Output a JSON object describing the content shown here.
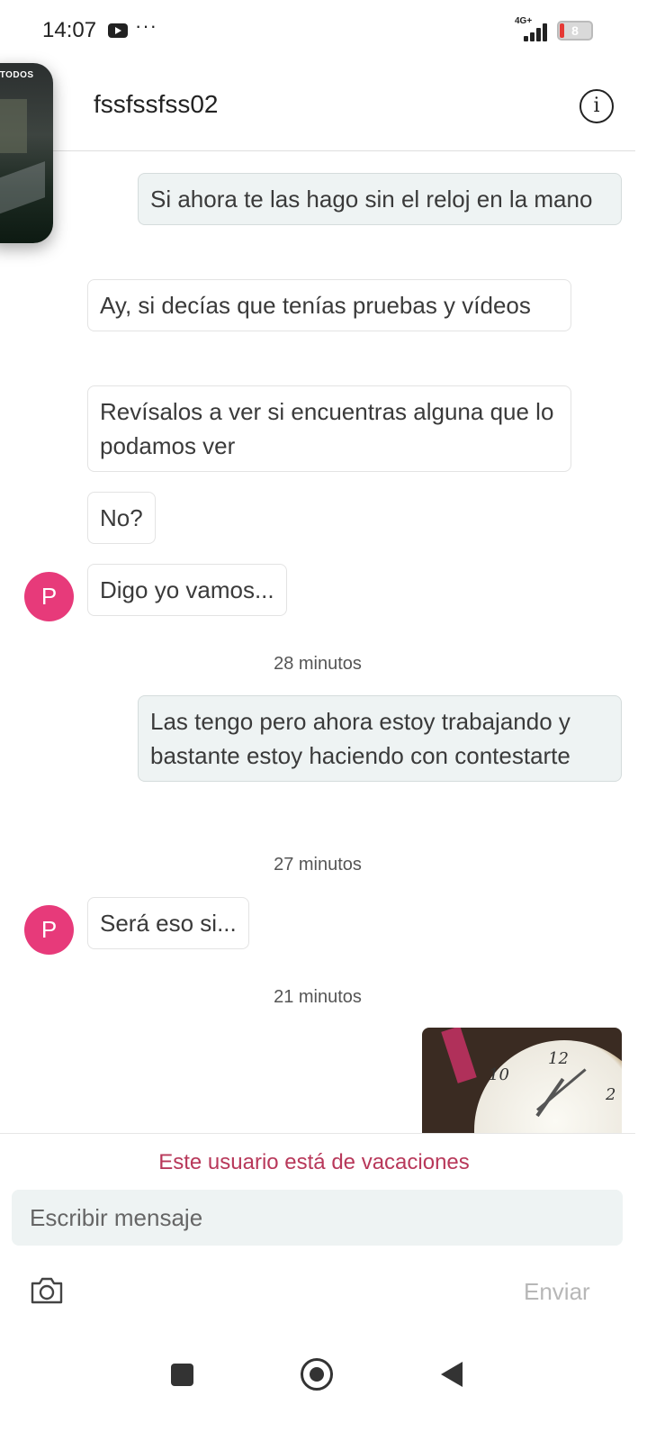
{
  "status_bar": {
    "time": "14:07",
    "more": "···",
    "network": "4G+",
    "battery": "8"
  },
  "header": {
    "title": "fssfssfss02",
    "info_icon": "info-icon"
  },
  "pip": {
    "label": "UTODOS"
  },
  "messages": [
    {
      "direction": "out",
      "text": "Si ahora te las hago sin el reloj en la mano"
    },
    {
      "direction": "in",
      "text": "Ay, si decías que tenías pruebas y vídeos"
    },
    {
      "direction": "in",
      "text": "Revísalos a ver si encuentras alguna que lo podamos ver"
    },
    {
      "direction": "in",
      "text": "No?"
    },
    {
      "direction": "in",
      "text": "Digo yo vamos...",
      "avatar": "P"
    },
    {
      "direction": "out",
      "text": "Las tengo pero ahora estoy trabajando y bastante estoy haciendo con contestarte"
    },
    {
      "direction": "in",
      "text": "Será eso si...",
      "avatar": "P"
    }
  ],
  "timestamps": [
    "28 minutos",
    "27 minutos",
    "21 minutos"
  ],
  "photo": {
    "dial_numbers": [
      "12",
      "10",
      "2"
    ]
  },
  "composer": {
    "vacation_notice": "Este usuario está de vacaciones",
    "placeholder": "Escribir mensaje",
    "send_label": "Enviar",
    "camera_icon": "camera-icon"
  },
  "colors": {
    "avatar": "#e73a7a",
    "vacation": "#b8385a",
    "outgoing_bubble": "#eef3f3"
  }
}
